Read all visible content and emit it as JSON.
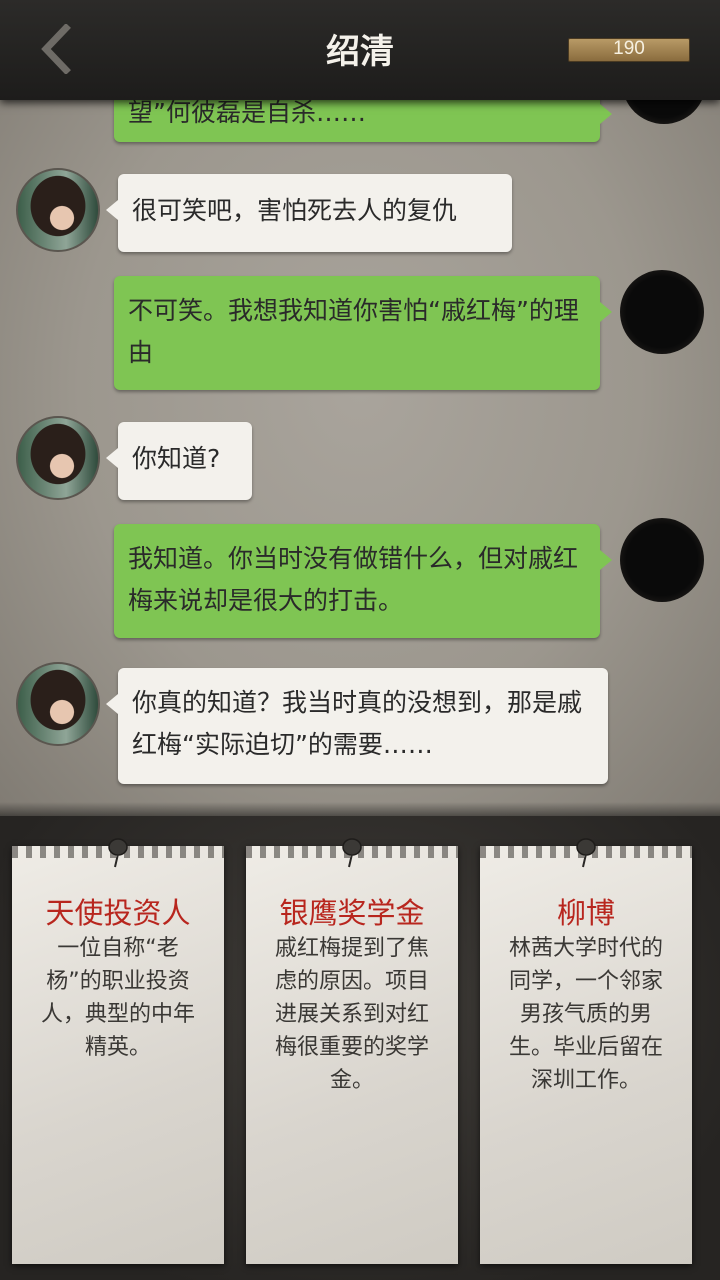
{
  "header": {
    "title": "绍清",
    "coins": "190"
  },
  "chat": {
    "messages": [
      {
        "from": "me",
        "text": "望”何彼磊是自杀……"
      },
      {
        "from": "her",
        "text": "很可笑吧，害怕死去人的复仇"
      },
      {
        "from": "me",
        "text": "不可笑。我想我知道你害怕“戚红梅”的理由"
      },
      {
        "from": "her",
        "text": "你知道?"
      },
      {
        "from": "me",
        "text": "我知道。你当时没有做错什么，但对戚红梅来说却是很大的打击。"
      },
      {
        "from": "her",
        "text": "你真的知道？我当时真的没想到，那是戚红梅“实际迫切”的需要……"
      }
    ]
  },
  "cards": [
    {
      "title": "天使投资人",
      "text": "一位自称“老杨”的职业投资人，典型的中年精英。"
    },
    {
      "title": "银鹰奖学金",
      "text": "戚红梅提到了焦虑的原因。项目进展关系到对红梅很重要的奖学金。"
    },
    {
      "title": "柳博",
      "text": "林茜大学时代的同学，一个邻家男孩气质的男生。毕业后留在深圳工作。"
    }
  ],
  "colors": {
    "green_bubble": "#7fc553",
    "white_bubble": "#f3f1ec",
    "card_title": "#b8261e"
  }
}
